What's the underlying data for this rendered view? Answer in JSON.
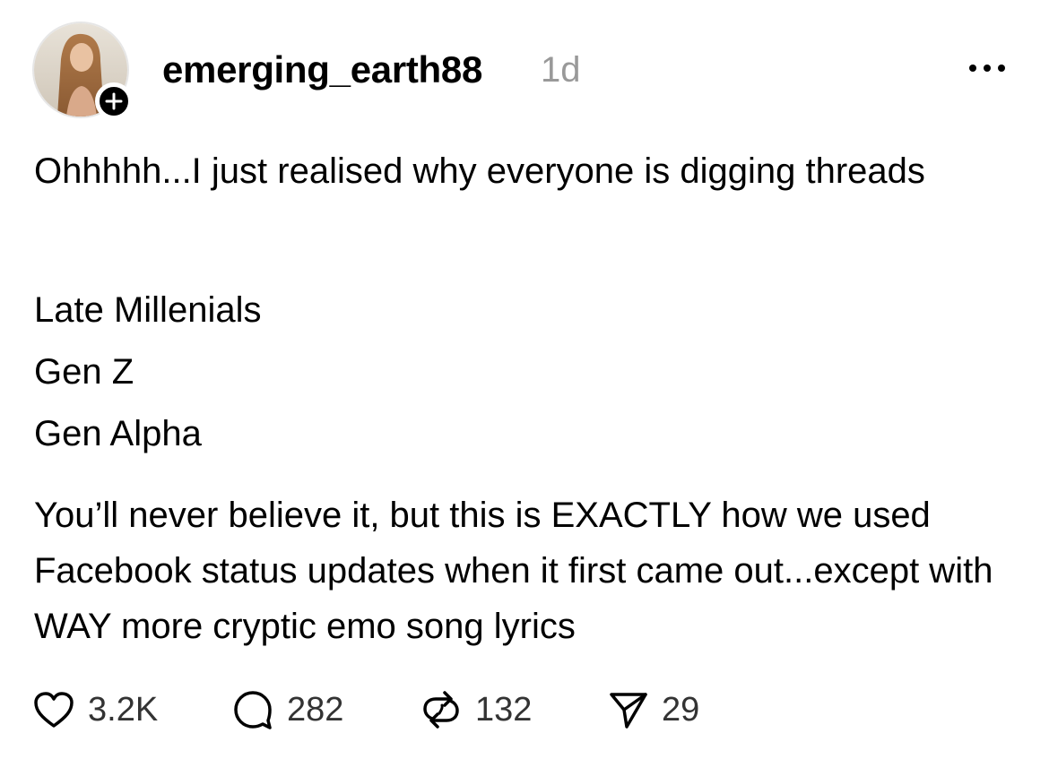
{
  "post": {
    "username": "emerging_earth88",
    "timestamp": "1d",
    "more_icon": "ellipsis-icon",
    "paragraphs": [
      "Ohhhhh...I just realised why everyone is digging threads",
      "You’ll never believe it, but this is EXACTLY how we used Facebook status updates when it first came out...except with WAY more cryptic emo song lyrics"
    ],
    "lines": [
      "Late Millenials",
      "Gen Z",
      "Gen Alpha"
    ]
  },
  "actions": {
    "like": {
      "icon": "heart-icon",
      "count": "3.2K"
    },
    "reply": {
      "icon": "comment-icon",
      "count": "282"
    },
    "repost": {
      "icon": "repost-icon",
      "count": "132"
    },
    "share": {
      "icon": "send-icon",
      "count": "29"
    }
  },
  "colors": {
    "text": "#000000",
    "muted": "#999999",
    "counts": "#333333",
    "background": "#ffffff"
  }
}
